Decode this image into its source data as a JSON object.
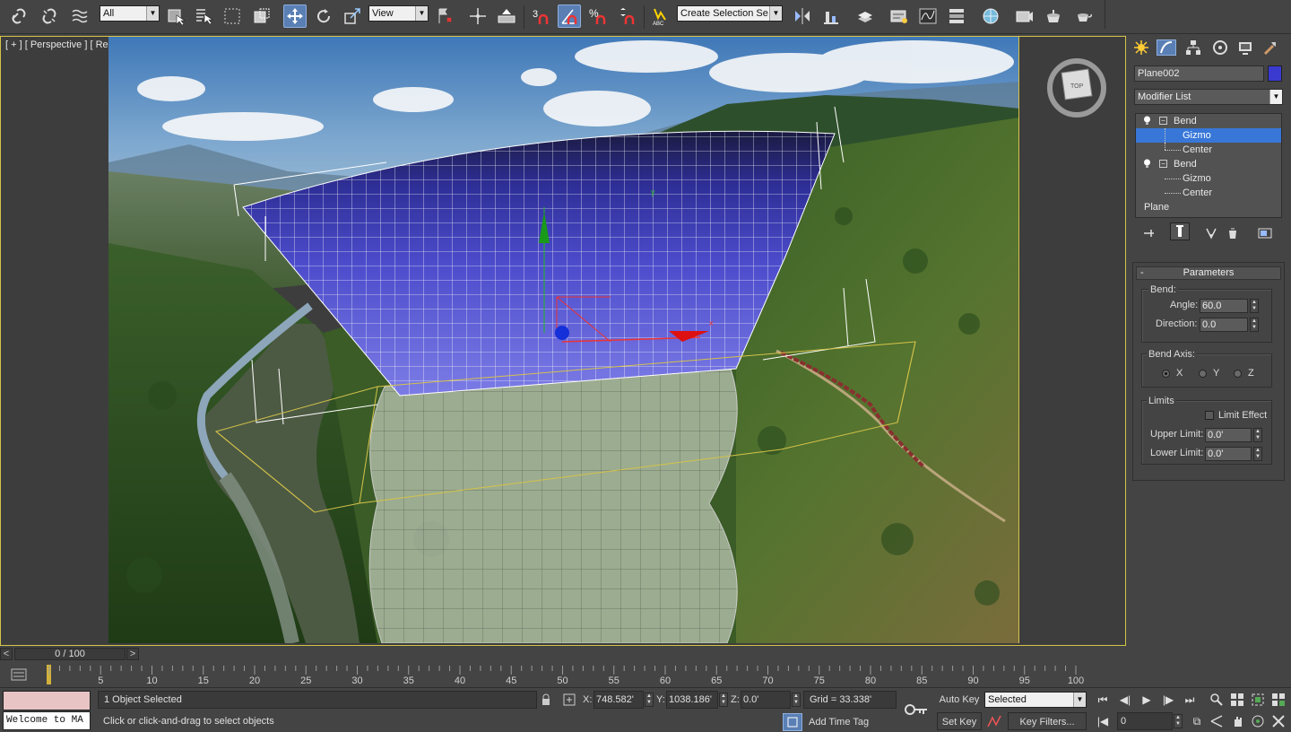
{
  "toolbar": {
    "selection_filter": "All",
    "ref_coord": "View",
    "snap_value": "3",
    "named_selection": "Create Selection Se"
  },
  "viewport": {
    "label_plus": "[ + ]",
    "label_view": "[ Perspective ]",
    "label_shading": "[ Realistic + Edged Faces ]",
    "viewcube_label": "TOP"
  },
  "command_panel": {
    "object_name": "Plane002",
    "object_color": "#3a3ad0",
    "modifier_list": "Modifier List",
    "stack": [
      {
        "label": "Bend",
        "level": 0,
        "selected": false
      },
      {
        "label": "Gizmo",
        "level": 1,
        "selected": true
      },
      {
        "label": "Center",
        "level": 1,
        "selected": false
      },
      {
        "label": "Bend",
        "level": 0,
        "selected": false
      },
      {
        "label": "Gizmo",
        "level": 1,
        "selected": false
      },
      {
        "label": "Center",
        "level": 1,
        "selected": false
      },
      {
        "label": "Plane",
        "level": 0,
        "selected": false
      }
    ],
    "rollout_title": "Parameters",
    "bend_group": "Bend:",
    "angle_label": "Angle:",
    "angle_value": "60.0",
    "direction_label": "Direction:",
    "direction_value": "0.0",
    "axis_group": "Bend Axis:",
    "axis_x": "X",
    "axis_y": "Y",
    "axis_z": "Z",
    "limits_group": "Limits",
    "limit_effect": "Limit Effect",
    "upper_label": "Upper Limit:",
    "upper_value": "0.0'",
    "lower_label": "Lower Limit:",
    "lower_value": "0.0'"
  },
  "timeline": {
    "frame": "0 / 100",
    "ticks": [
      "5",
      "10",
      "15",
      "20",
      "25",
      "30",
      "35",
      "40",
      "45",
      "50",
      "55",
      "60",
      "65",
      "70",
      "75",
      "80",
      "85",
      "90",
      "95",
      "100"
    ],
    "total_frames": 100
  },
  "status": {
    "maxscript_text": "Welcome to MA",
    "selection_count": "1 Object Selected",
    "prompt": "Click or click-and-drag to select objects",
    "x_label": "X:",
    "x_value": "748.582'",
    "y_label": "Y:",
    "y_value": "1038.186'",
    "z_label": "Z:",
    "z_value": "0.0'",
    "grid": "Grid = 33.338'",
    "add_time_tag": "Add Time Tag",
    "auto_key": "Auto Key",
    "key_mode": "Selected",
    "set_key": "Set Key",
    "key_filters": "Key Filters...",
    "current_frame": "0"
  }
}
